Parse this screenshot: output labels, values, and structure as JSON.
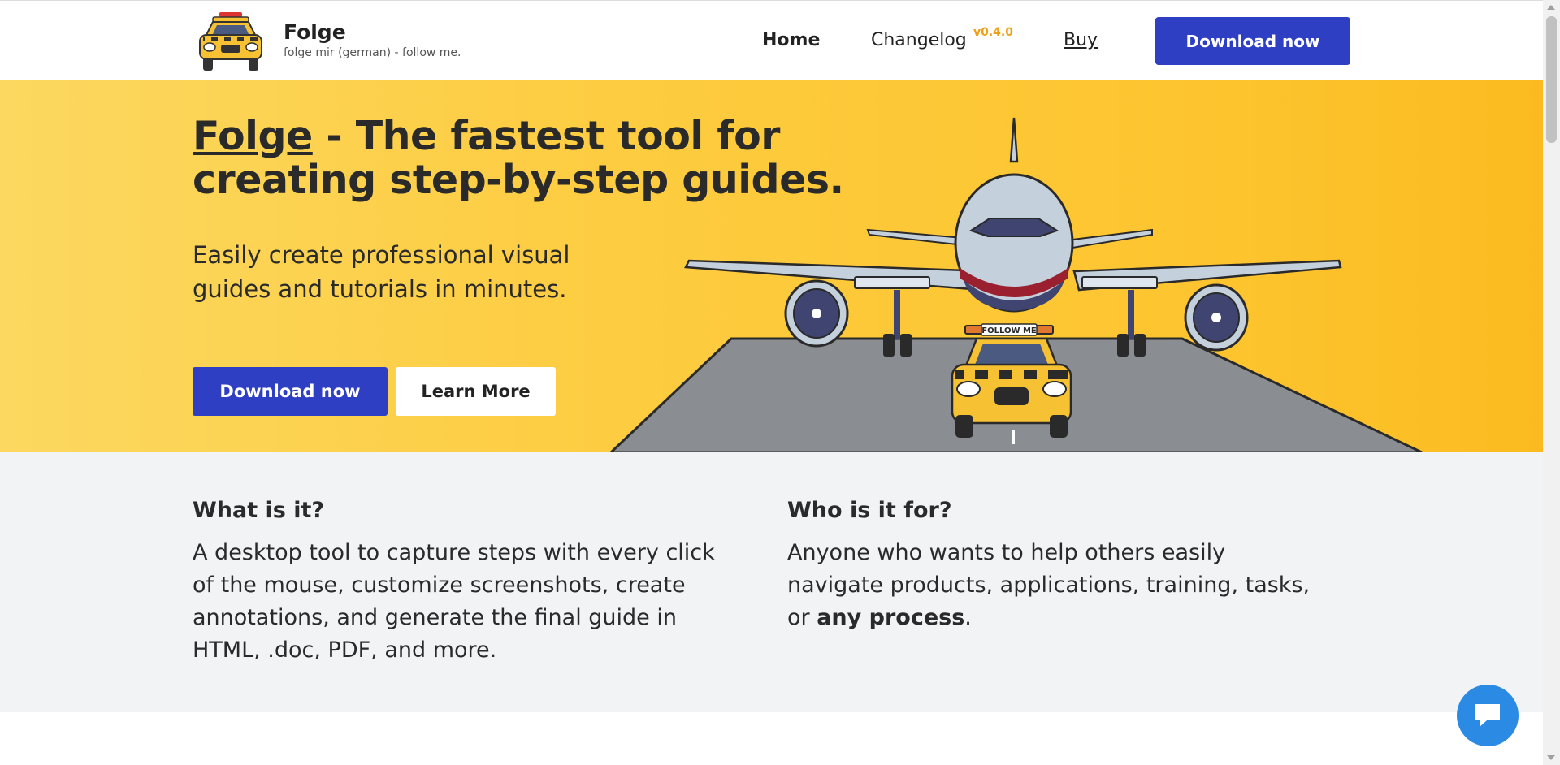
{
  "header": {
    "brand_name": "Folge",
    "brand_tagline": "folge mir (german) - follow me.",
    "nav": {
      "home": "Home",
      "changelog": "Changelog",
      "version": "v0.4.0",
      "buy": "Buy"
    },
    "cta": "Download now"
  },
  "hero": {
    "title_brand": "Folge",
    "title_rest": " - The fastest tool for creating step-by-step guides.",
    "subtitle": "Easily create professional visual guides and tutorials in minutes.",
    "download_button": "Download now",
    "learn_more_button": "Learn More",
    "car_sign": "FOLLOW ME"
  },
  "info": {
    "what": {
      "title": "What is it?",
      "text": "A desktop tool to capture steps with every click of the mouse, customize screenshots, create annotations, and generate the final guide in HTML, .doc, PDF, and more."
    },
    "who": {
      "title": "Who is it for?",
      "text_before": "Anyone who wants to help others easily navigate products, applications, training, tasks, or ",
      "text_bold": "any process",
      "text_after": "."
    }
  },
  "colors": {
    "primary": "#2f3fc4",
    "hero_yellow": "#fdcc40",
    "version_orange": "#f0a018",
    "chat_blue": "#2b8ae4",
    "info_bg": "#f2f3f5"
  },
  "icons": {
    "logo": "taxi-car-logo",
    "chat": "chat-bubble-icon",
    "hero_illustration": "airplane-follow-me-car"
  }
}
